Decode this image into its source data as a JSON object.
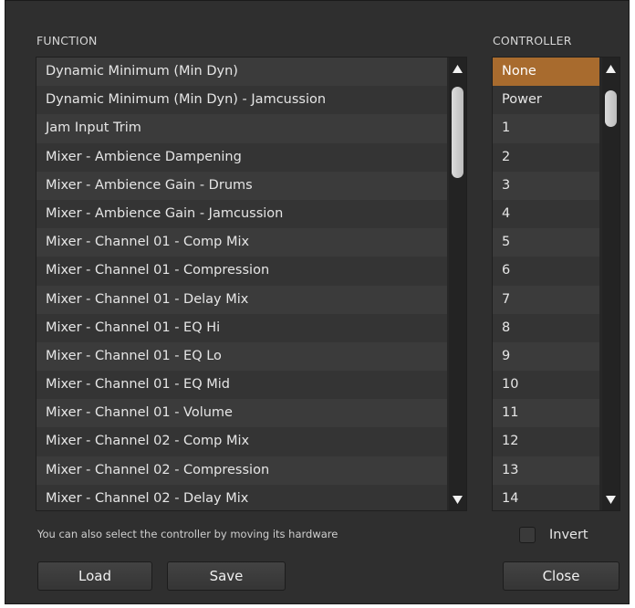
{
  "function_header": "FUNCTION",
  "controller_header": "CONTROLLER",
  "functions": [
    "Dynamic Minimum (Min Dyn)",
    "Dynamic Minimum (Min Dyn) - Jamcussion",
    "Jam Input Trim",
    "Mixer - Ambience Dampening",
    "Mixer - Ambience Gain - Drums",
    "Mixer - Ambience Gain - Jamcussion",
    "Mixer - Channel 01 - Comp Mix",
    "Mixer - Channel 01 - Compression",
    "Mixer - Channel 01 - Delay Mix",
    "Mixer - Channel 01 - EQ Hi",
    "Mixer - Channel 01 - EQ Lo",
    "Mixer - Channel 01 - EQ Mid",
    "Mixer - Channel 01 - Volume",
    "Mixer - Channel 02 - Comp Mix",
    "Mixer - Channel 02 - Compression",
    "Mixer - Channel 02 - Delay Mix"
  ],
  "controllers": [
    "None",
    "Power",
    "1",
    "2",
    "3",
    "4",
    "5",
    "6",
    "7",
    "8",
    "9",
    "10",
    "11",
    "12",
    "13",
    "14"
  ],
  "selected_controller": "None",
  "hint": "You can also select the controller by moving its hardware",
  "invert_label": "Invert",
  "invert_checked": false,
  "buttons": {
    "load": "Load",
    "save": "Save",
    "close": "Close"
  },
  "icons": {
    "scroll_up": "triangle-up-icon",
    "scroll_down": "triangle-down-icon"
  },
  "colors": {
    "selected": "#a86b2e",
    "panel": "#2f2f2f"
  }
}
